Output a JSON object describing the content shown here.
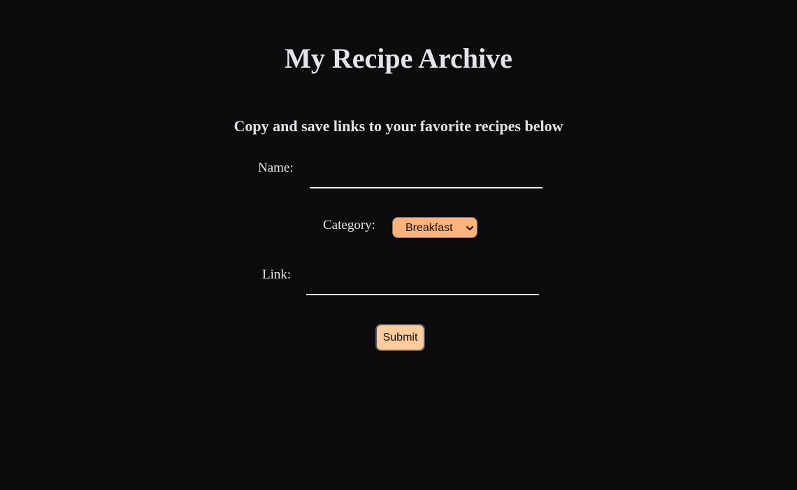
{
  "header": {
    "title": "My Recipe Archive",
    "subtitle": "Copy and save links to your favorite recipes below"
  },
  "form": {
    "name_label": "Name:",
    "name_value": "",
    "category_label": "Category:",
    "category_selected": "Breakfast",
    "link_label": "Link:",
    "link_value": "",
    "submit_label": "Submit"
  },
  "colors": {
    "background": "#0d0b0e",
    "text": "#e6e3e8",
    "select_fill": "#ffb27a",
    "button_fill": "#ffcc9e"
  },
  "icons": {
    "select": "chevron-down-icon"
  }
}
